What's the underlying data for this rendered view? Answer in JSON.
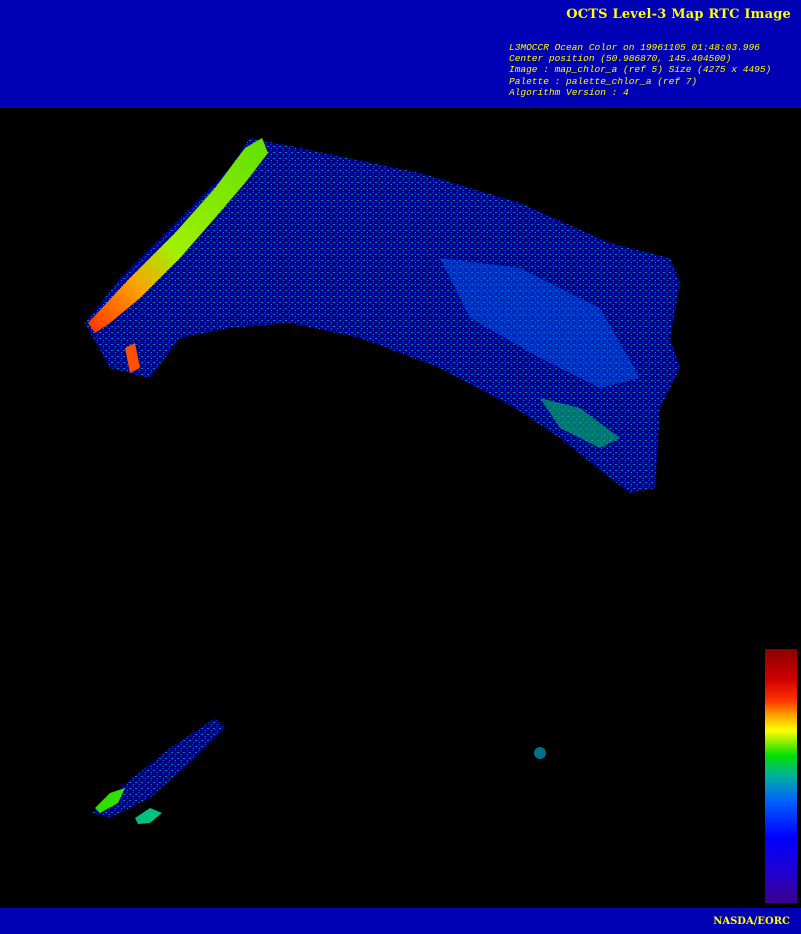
{
  "header": {
    "title": "OCTS Level-3 Map RTC Image",
    "meta_lines": [
      "L3MOCCR Ocean Color on 19961105 01:48:03.996",
      "Center position (50.986870, 145.404500)",
      "Image : map_chlor_a (ref 5) Size (4275 x 4495)",
      "Palette : palette_chlor_a (ref 7)",
      "Algorithm Version : 4"
    ]
  },
  "footer": {
    "credit": "NASDA/EORC"
  },
  "colors": {
    "header_bg": "#0000b4",
    "text": "#ffff00",
    "background": "#000000"
  },
  "map": {
    "variable": "chlorophyll-a",
    "colorbar_palette": [
      "#3d008c",
      "#0000ff",
      "#00b0a0",
      "#00e000",
      "#ffff00",
      "#ff3000",
      "#8c0000"
    ]
  }
}
